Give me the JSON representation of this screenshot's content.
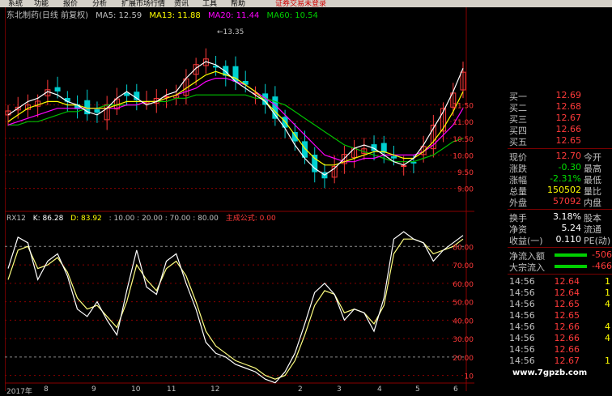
{
  "menubar": {
    "items": [
      "系统",
      "功能",
      "报价",
      "分析",
      "扩展市场行情",
      "资讯",
      "工具",
      "帮助"
    ],
    "promo": "证券交易未登录"
  },
  "upper_header": {
    "title": "东北制药(日线 前复权)",
    "ma5": "MA5: 12.59",
    "ma13": "MA13: 11.88",
    "ma20": "MA20: 11.44",
    "ma60": "MA60: 10.54"
  },
  "lower_header": {
    "indicator": "RX12",
    "k": "K: 86.28",
    "d": "D: 83.92",
    "params": ": 10.00 : 20.00 : 70.00 : 80.00",
    "formula": "主成公式: 0.00"
  },
  "colors": {
    "bg": "#000000",
    "up": "#ff3a3a",
    "down": "#00d0d0",
    "ma5": "#ffffff",
    "ma13": "#ffff00",
    "ma20": "#ff00ff",
    "ma60": "#00c000",
    "grid_red": "#8a0000",
    "green_val": "#00e000"
  },
  "right_panel": {
    "bids": [
      {
        "label": "买一",
        "price": "12.69"
      },
      {
        "label": "买二",
        "price": "12.68"
      },
      {
        "label": "买三",
        "price": "12.67"
      },
      {
        "label": "买四",
        "price": "12.66"
      },
      {
        "label": "买五",
        "price": "12.65"
      }
    ],
    "quote": [
      {
        "label": "现价",
        "value": "12.70",
        "extra": "今开",
        "color": "#ff3a3a"
      },
      {
        "label": "涨跌",
        "value": "-0.30",
        "extra": "最高",
        "color": "#00e000"
      },
      {
        "label": "涨幅",
        "value": "-2.31%",
        "extra": "最低",
        "color": "#00e000"
      },
      {
        "label": "总量",
        "value": "150502",
        "extra": "量比",
        "color": "#ffff00"
      },
      {
        "label": "外盘",
        "value": "57092",
        "extra": "内盘",
        "color": "#ff3a3a"
      }
    ],
    "fund": [
      {
        "label": "换手",
        "value": "3.18%",
        "extra": "股本"
      },
      {
        "label": "净资",
        "value": "5.24",
        "extra": "流通"
      },
      {
        "label": "收益(一)",
        "value": "0.110",
        "extra": "PE(动)"
      }
    ],
    "flow": [
      {
        "label": "净流入额",
        "value": "-506"
      },
      {
        "label": "大宗流入",
        "value": "-466"
      }
    ],
    "ticks": [
      {
        "time": "14:56",
        "price": "12.64",
        "vol": "1"
      },
      {
        "time": "14:56",
        "price": "12.64",
        "vol": "1"
      },
      {
        "time": "14:56",
        "price": "12.65",
        "vol": "4"
      },
      {
        "time": "14:56",
        "price": "12.65",
        "vol": ""
      },
      {
        "time": "14:56",
        "price": "12.66",
        "vol": "4"
      },
      {
        "time": "14:56",
        "price": "12.66",
        "vol": "4"
      },
      {
        "time": "14:56",
        "price": "12.66",
        "vol": ""
      },
      {
        "time": "14:56",
        "price": "12.67",
        "vol": "1"
      }
    ]
  },
  "upper_axis": [
    "11.50",
    "11.00",
    "10.50",
    "10.00",
    "9.50",
    "9.00"
  ],
  "lower_axis": [
    "80.00",
    "70.00",
    "60.00",
    "50.00",
    "40.00",
    "30.00",
    "20.00",
    "10"
  ],
  "high_label": "13.35",
  "date_axis": [
    "2017年",
    "8",
    "9",
    "10",
    "11",
    "12",
    "2",
    "3",
    "4",
    "5",
    "6"
  ],
  "watermark": "www.7gpzb.com",
  "chart_data": [
    {
      "type": "candlestick",
      "x_range": [
        0,
        100
      ],
      "y_range": [
        8.7,
        13.6
      ],
      "y_ticks": [
        9.0,
        9.5,
        10.0,
        10.5,
        11.0,
        11.5
      ],
      "ma5": [
        11.2,
        11.4,
        11.6,
        11.7,
        11.9,
        11.8,
        11.6,
        11.5,
        11.3,
        11.2,
        11.4,
        11.7,
        11.9,
        11.7,
        11.5,
        11.6,
        11.8,
        11.9,
        12.3,
        12.6,
        12.8,
        12.7,
        12.5,
        12.2,
        12.0,
        11.8,
        11.6,
        11.2,
        10.8,
        10.3,
        9.9,
        9.6,
        9.4,
        9.6,
        9.9,
        10.2,
        10.3,
        10.2,
        10.0,
        9.8,
        9.7,
        9.9,
        10.3,
        10.8,
        11.3,
        11.9,
        12.6
      ],
      "ma13": [
        11.0,
        11.2,
        11.4,
        11.5,
        11.6,
        11.6,
        11.5,
        11.5,
        11.4,
        11.4,
        11.4,
        11.5,
        11.6,
        11.6,
        11.6,
        11.6,
        11.7,
        11.8,
        12.0,
        12.2,
        12.4,
        12.5,
        12.4,
        12.3,
        12.1,
        11.9,
        11.6,
        11.3,
        11.0,
        10.6,
        10.2,
        9.9,
        9.7,
        9.7,
        9.8,
        9.9,
        10.0,
        10.1,
        10.1,
        10.0,
        9.9,
        9.9,
        10.1,
        10.4,
        10.8,
        11.3,
        11.9
      ],
      "ma20": [
        10.9,
        11.0,
        11.1,
        11.2,
        11.3,
        11.4,
        11.4,
        11.4,
        11.4,
        11.4,
        11.4,
        11.4,
        11.5,
        11.5,
        11.6,
        11.6,
        11.7,
        11.8,
        11.9,
        12.0,
        12.2,
        12.3,
        12.3,
        12.2,
        12.1,
        11.9,
        11.7,
        11.5,
        11.2,
        10.9,
        10.6,
        10.3,
        10.0,
        9.9,
        9.8,
        9.8,
        9.9,
        9.9,
        10.0,
        10.0,
        10.0,
        10.0,
        10.1,
        10.3,
        10.6,
        10.9,
        11.4
      ],
      "ma60": [
        10.9,
        10.9,
        11.0,
        11.0,
        11.1,
        11.2,
        11.3,
        11.3,
        11.4,
        11.4,
        11.5,
        11.5,
        11.5,
        11.5,
        11.6,
        11.6,
        11.6,
        11.7,
        11.7,
        11.8,
        11.8,
        11.8,
        11.8,
        11.8,
        11.8,
        11.7,
        11.7,
        11.6,
        11.5,
        11.3,
        11.1,
        10.9,
        10.7,
        10.5,
        10.3,
        10.2,
        10.1,
        10.0,
        9.9,
        9.8,
        9.8,
        9.8,
        9.9,
        10.0,
        10.2,
        10.4,
        10.5
      ]
    },
    {
      "type": "line",
      "y_range": [
        5,
        92
      ],
      "y_ticks": [
        10,
        20,
        30,
        40,
        50,
        60,
        70,
        80
      ],
      "series": [
        {
          "name": "K",
          "values": [
            68,
            85,
            82,
            62,
            72,
            76,
            64,
            46,
            42,
            50,
            40,
            32,
            56,
            78,
            58,
            54,
            72,
            76,
            60,
            46,
            28,
            22,
            20,
            16,
            14,
            12,
            8,
            6,
            12,
            22,
            38,
            55,
            60,
            54,
            40,
            46,
            44,
            34,
            52,
            84,
            88,
            84,
            82,
            72,
            78,
            82,
            86
          ]
        },
        {
          "name": "D",
          "values": [
            62,
            78,
            80,
            68,
            70,
            74,
            66,
            52,
            46,
            48,
            42,
            36,
            50,
            70,
            62,
            56,
            68,
            72,
            64,
            50,
            34,
            26,
            22,
            18,
            16,
            14,
            10,
            8,
            10,
            18,
            32,
            48,
            56,
            54,
            44,
            46,
            44,
            38,
            48,
            76,
            84,
            84,
            82,
            76,
            78,
            80,
            84
          ]
        }
      ]
    }
  ]
}
